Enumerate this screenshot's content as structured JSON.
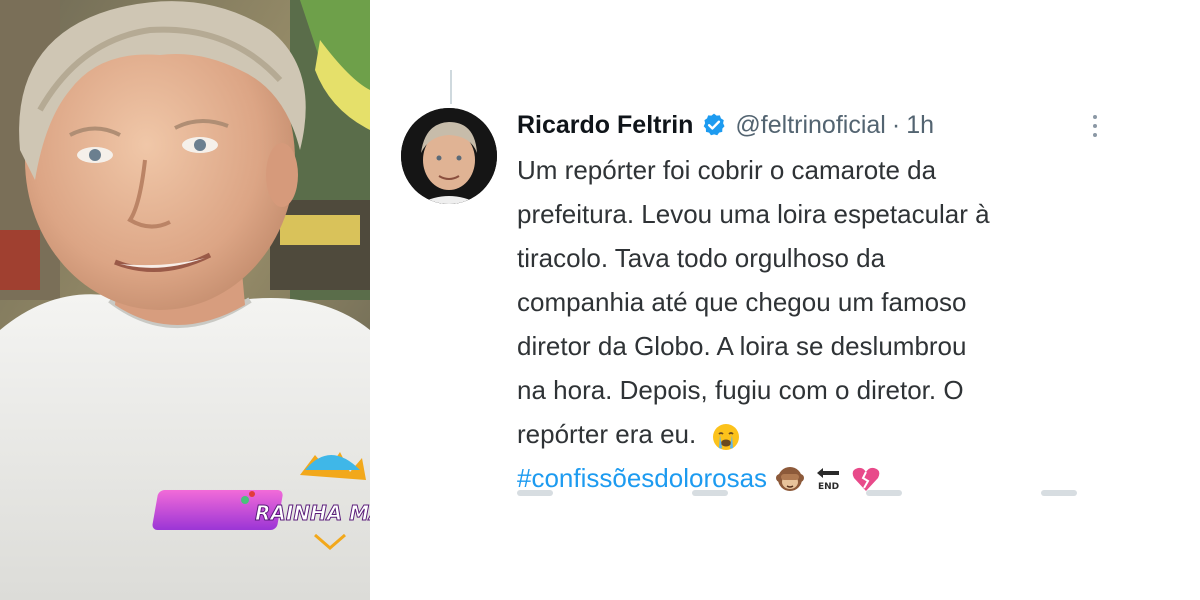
{
  "photo": {
    "sticker_text": "RAINHA MA"
  },
  "tweet": {
    "author_name": "Ricardo Feltrin",
    "handle": "@feltrinoficial",
    "separator": "·",
    "time": "1h",
    "text_lines": [
      "Um repórter foi cobrir o camarote da",
      "prefeitura. Levou uma loira espetacular à",
      "tiracolo. Tava todo orgulhoso da",
      "companhia até que chegou um famoso",
      "diretor da Globo. A loira se deslumbrou",
      "na hora. Depois, fugiu com o diretor. O",
      "repórter era eu."
    ],
    "hashtag": "#confissõesdolorosas",
    "icons": {
      "verified": "verified-badge-icon",
      "more": "more-options-icon",
      "crying": "crying-face-emoji",
      "monkey": "see-no-evil-monkey-emoji",
      "end": "end-arrow-emoji",
      "heart": "broken-heart-emoji"
    },
    "colors": {
      "hashtag": "#1d9bf0",
      "verified": "#1d9bf0",
      "name": "#0f1419",
      "muted": "#536471"
    }
  }
}
